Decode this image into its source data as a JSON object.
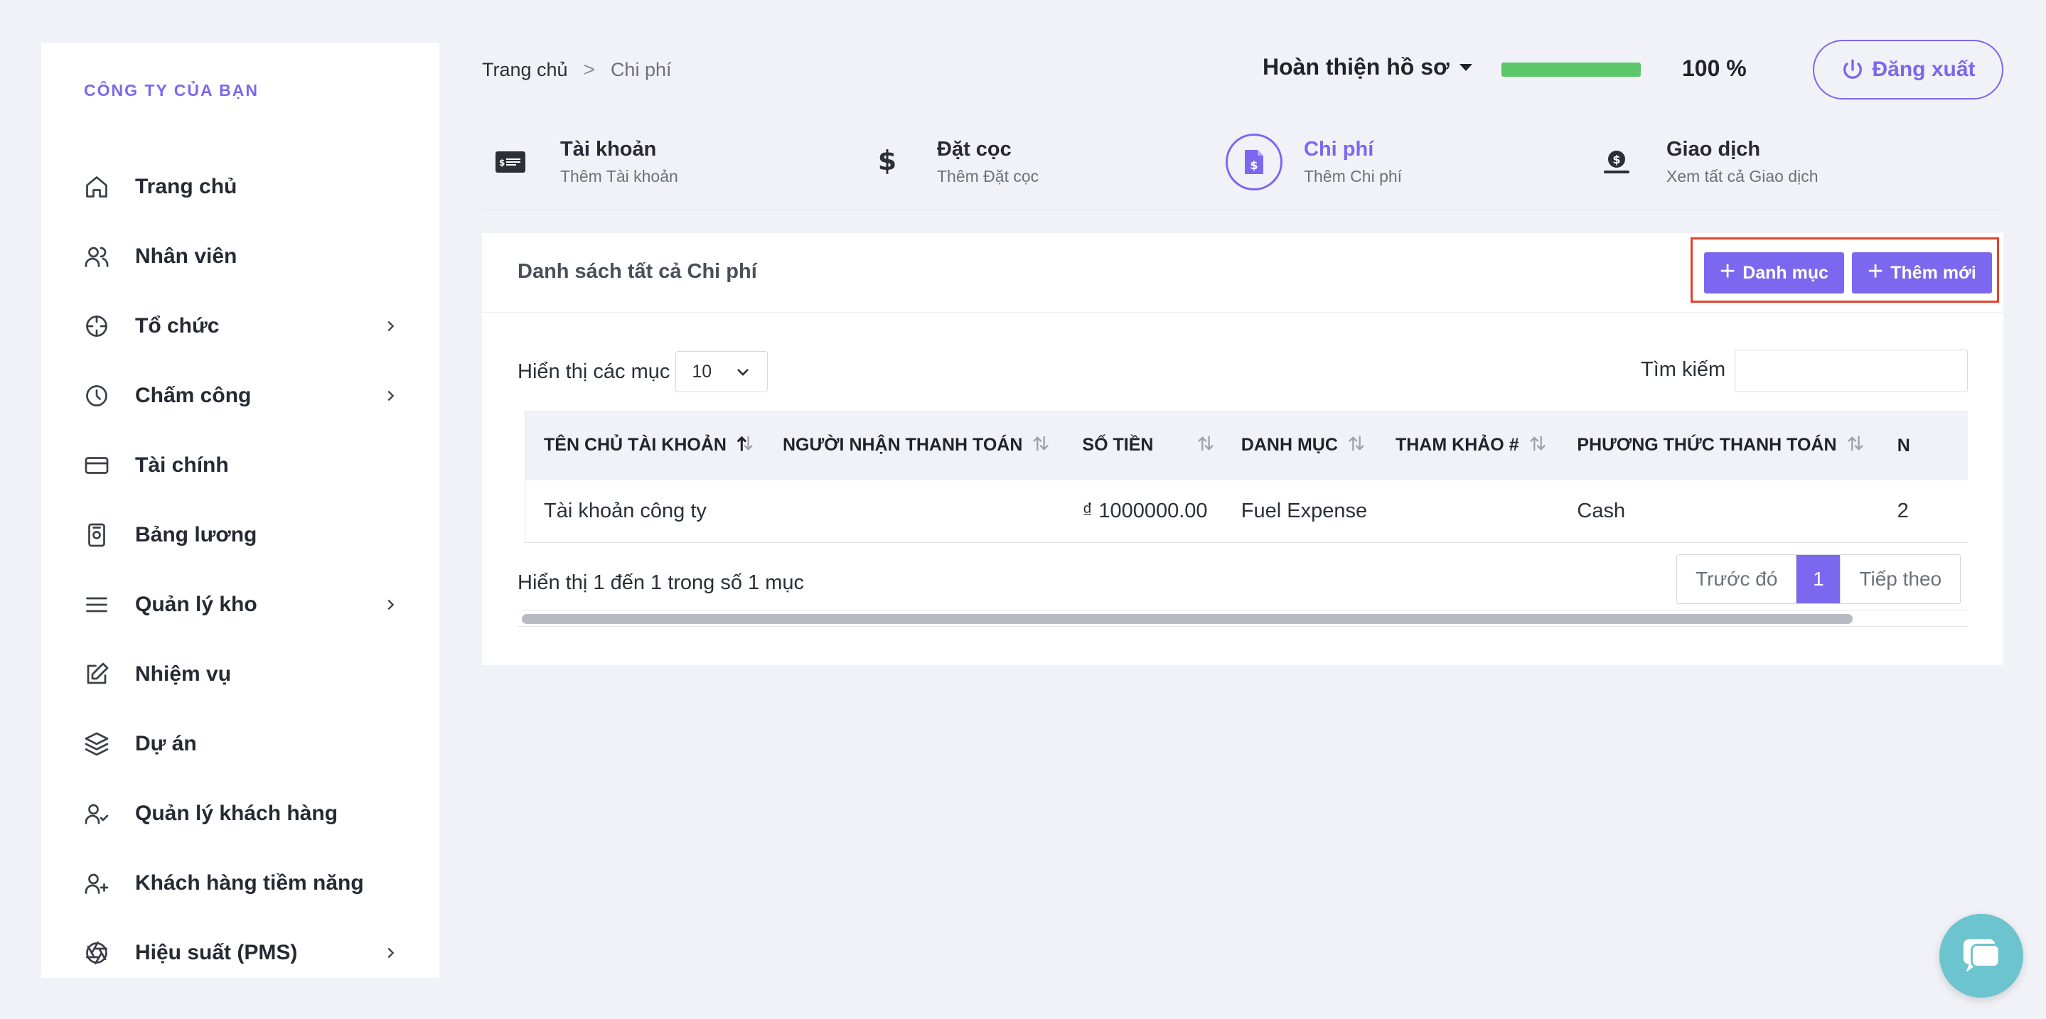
{
  "sidebar": {
    "company": "CÔNG TY CỦA BẠN",
    "items": [
      {
        "label": "Trang chủ",
        "icon": "home-icon",
        "has_submenu": false
      },
      {
        "label": "Nhân viên",
        "icon": "users-icon",
        "has_submenu": false
      },
      {
        "label": "Tổ chức",
        "icon": "crosshair-icon",
        "has_submenu": true
      },
      {
        "label": "Chấm công",
        "icon": "clock-icon",
        "has_submenu": true
      },
      {
        "label": "Tài chính",
        "icon": "credit-card-icon",
        "has_submenu": false
      },
      {
        "label": "Bảng lương",
        "icon": "payslip-icon",
        "has_submenu": false
      },
      {
        "label": "Quản lý kho",
        "icon": "menu-lines-icon",
        "has_submenu": true
      },
      {
        "label": "Nhiệm vụ",
        "icon": "edit-icon",
        "has_submenu": false
      },
      {
        "label": "Dự án",
        "icon": "layers-icon",
        "has_submenu": false
      },
      {
        "label": "Quản lý khách hàng",
        "icon": "user-check-icon",
        "has_submenu": false
      },
      {
        "label": "Khách hàng tiềm năng",
        "icon": "user-plus-icon",
        "has_submenu": false
      },
      {
        "label": "Hiệu suất (PMS)",
        "icon": "aperture-icon",
        "has_submenu": true
      }
    ]
  },
  "header": {
    "breadcrumb": {
      "home": "Trang chủ",
      "separator": ">",
      "current": "Chi phí"
    },
    "profile_label": "Hoàn thiện hồ sơ",
    "progress_percent": 100,
    "progress_text": "100 %",
    "logout_label": "Đăng xuất"
  },
  "quick_tabs": [
    {
      "title": "Tài khoản",
      "subtitle": "Thêm Tài khoản",
      "icon": "account-card-icon",
      "active": false
    },
    {
      "title": "Đặt cọc",
      "subtitle": "Thêm Đặt cọc",
      "icon": "dollar-icon",
      "active": false
    },
    {
      "title": "Chi phí",
      "subtitle": "Thêm Chi phí",
      "icon": "expense-doc-icon",
      "active": true
    },
    {
      "title": "Giao dịch",
      "subtitle": "Xem tất cả Giao dịch",
      "icon": "money-hand-icon",
      "active": false
    }
  ],
  "card": {
    "title": "Danh sách tất cả Chi phí",
    "category_button": "Danh mục",
    "add_button": "Thêm mới",
    "show_entries_label": "Hiển thị các mục",
    "page_size": "10",
    "search_label": "Tìm kiếm",
    "search_value": "",
    "columns": [
      "TÊN CHỦ TÀI KHOẢN",
      "NGƯỜI NHẬN THANH TOÁN",
      "SỐ TIỀN",
      "DANH MỤC",
      "THAM KHẢO #",
      "PHƯƠNG THỨC THANH TOÁN",
      "N"
    ],
    "rows": [
      [
        "Tài khoản công ty",
        "",
        "₫ 1000000.00",
        "Fuel Expense",
        "",
        "Cash",
        "2"
      ]
    ],
    "info_text": "Hiển thị 1 đến 1 trong số 1 mục",
    "pagination": {
      "prev": "Trước đó",
      "current": "1",
      "next": "Tiếp theo"
    }
  },
  "colors": {
    "accent": "#7b68ee",
    "progress": "#5cc66a",
    "highlight_border": "#e3432b",
    "chat": "#6cc4cf"
  }
}
